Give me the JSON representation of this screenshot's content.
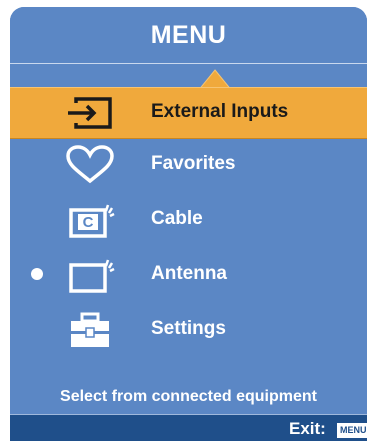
{
  "menu": {
    "title": "MENU",
    "items": [
      {
        "label": "External Inputs",
        "icon": "input-icon",
        "selected": true
      },
      {
        "label": "Favorites",
        "icon": "heart-icon",
        "selected": false
      },
      {
        "label": "Cable",
        "icon": "cable-tv-icon",
        "selected": false
      },
      {
        "label": "Antenna",
        "icon": "antenna-tv-icon",
        "selected": false,
        "active": true
      },
      {
        "label": "Settings",
        "icon": "toolbox-icon",
        "selected": false
      }
    ],
    "hint": "Select from connected equipment",
    "exit_label": "Exit:",
    "exit_key": "MENU",
    "cable_badge": "C"
  },
  "colors": {
    "panel": "#5b87c5",
    "highlight": "#f0a93c",
    "footer": "#1f4f8a",
    "text": "#ffffff"
  }
}
